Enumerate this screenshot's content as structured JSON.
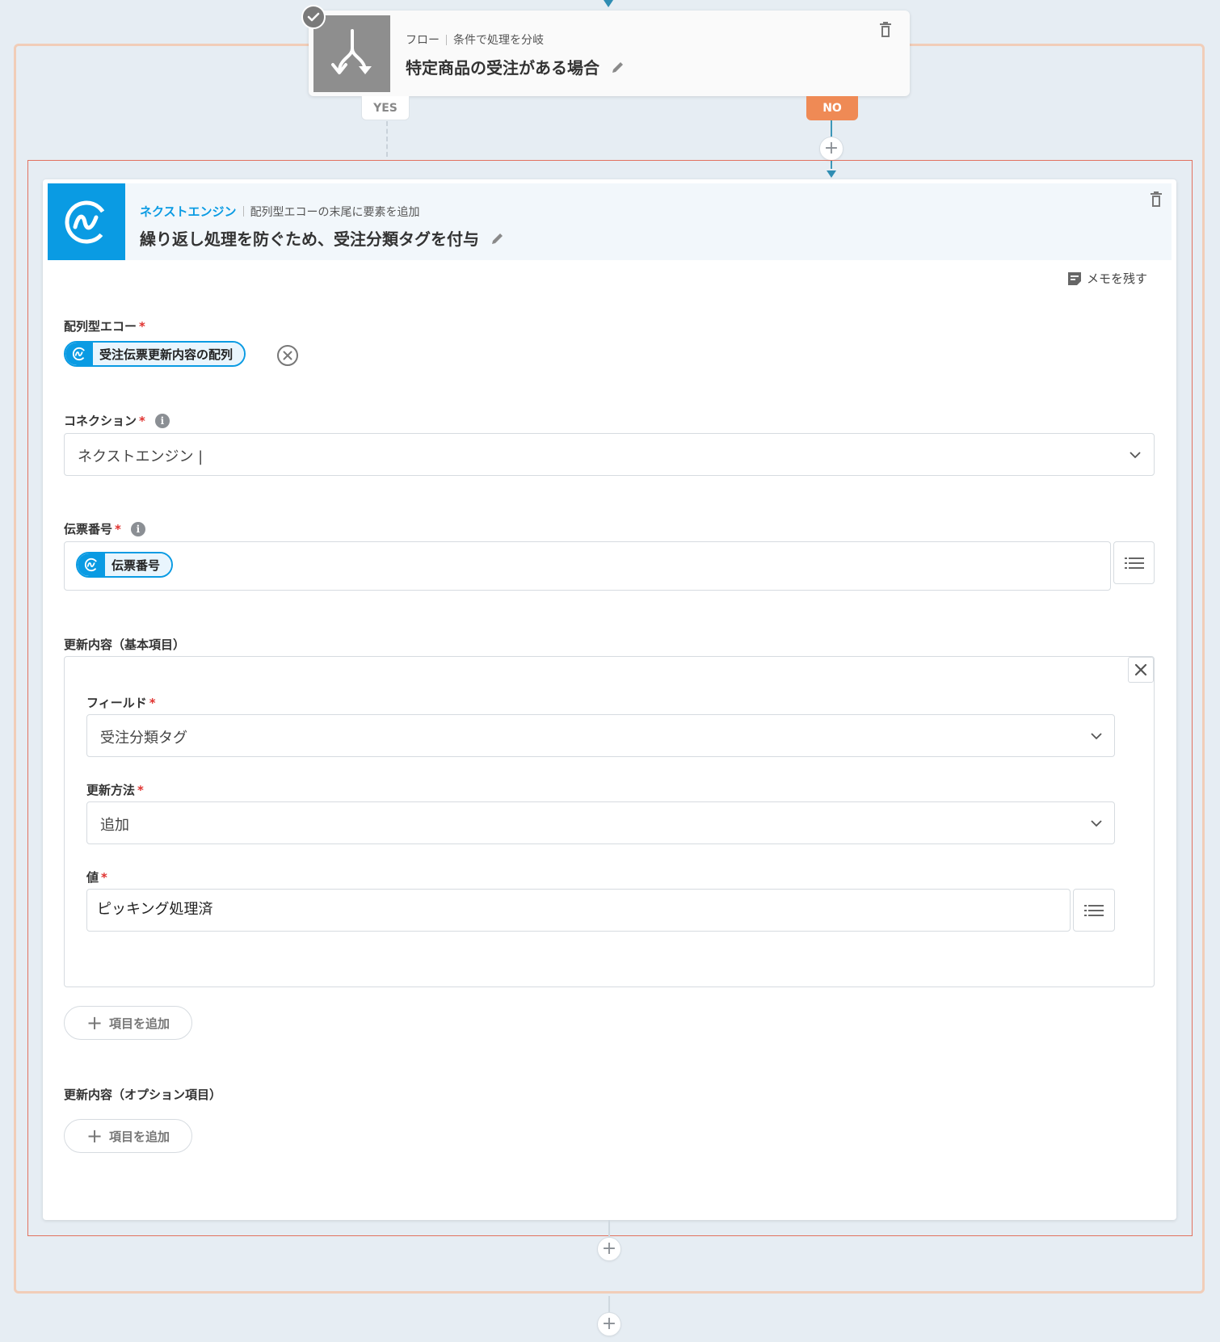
{
  "flow_card": {
    "service": "フロー",
    "action": "条件で処理を分岐",
    "title": "特定商品の受注がある場合"
  },
  "branches": {
    "yes": "YES",
    "no": "NO"
  },
  "action_card": {
    "service": "ネクストエンジン",
    "action": "配列型エコーの末尾に要素を追加",
    "title": "繰り返し処理を防ぐため、受注分類タグを付与",
    "memo": "メモを残す",
    "fields": {
      "array_echo": {
        "label": "配列型エコー",
        "required": "*",
        "value": "受注伝票更新内容の配列"
      },
      "connection": {
        "label": "コネクション",
        "required": "*",
        "value": "ネクストエンジン |"
      },
      "slip_number": {
        "label": "伝票番号",
        "required": "*",
        "value": "伝票番号"
      },
      "update_basic": {
        "label": "更新内容（基本項目）",
        "field": {
          "label": "フィールド",
          "required": "*",
          "value": "受注分類タグ"
        },
        "method": {
          "label": "更新方法",
          "required": "*",
          "value": "追加"
        },
        "value": {
          "label": "値",
          "required": "*",
          "value": "ピッキング処理済"
        },
        "add_button": "項目を追加"
      },
      "update_option": {
        "label": "更新内容（オプション項目）",
        "add_button": "項目を追加"
      }
    }
  },
  "colors": {
    "accent": "#0a9be3",
    "no_branch": "#ef8a55",
    "selection": "#e2725f",
    "group_border": "#f1cdb8",
    "required": "#e0322f"
  },
  "icons": [
    "check-icon",
    "branch-icon",
    "trash-icon",
    "edit-icon",
    "nextengine-logo-icon",
    "memo-icon",
    "clear-circle-icon",
    "info-icon",
    "chevron-down-icon",
    "list-icon",
    "close-icon",
    "plus-icon"
  ]
}
